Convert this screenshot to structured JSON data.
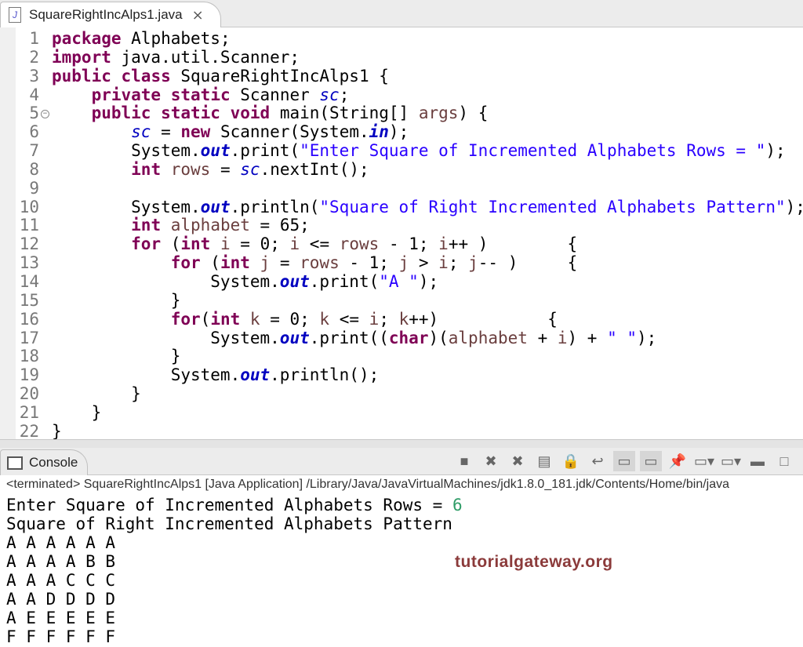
{
  "editor": {
    "tab_title": "SquareRightIncAlps1.java",
    "file_icon": "J",
    "close_icon": "⨯",
    "lines": [
      [
        [
          "k",
          "package"
        ],
        [
          "p",
          " Alphabets;"
        ]
      ],
      [
        [
          "k",
          "import"
        ],
        [
          "p",
          " java.util.Scanner;"
        ]
      ],
      [
        [
          "k",
          "public"
        ],
        [
          "p",
          " "
        ],
        [
          "k",
          "class"
        ],
        [
          "p",
          " SquareRightIncAlps1 {"
        ]
      ],
      [
        [
          "p",
          "    "
        ],
        [
          "k",
          "private"
        ],
        [
          "p",
          " "
        ],
        [
          "k",
          "static"
        ],
        [
          "p",
          " Scanner "
        ],
        [
          "v",
          "sc"
        ],
        [
          "p",
          ";"
        ]
      ],
      [
        [
          "p",
          "    "
        ],
        [
          "k",
          "public"
        ],
        [
          "p",
          " "
        ],
        [
          "k",
          "static"
        ],
        [
          "p",
          " "
        ],
        [
          "k",
          "void"
        ],
        [
          "p",
          " main(String[] "
        ],
        [
          "l",
          "args"
        ],
        [
          "p",
          ") {"
        ]
      ],
      [
        [
          "p",
          "        "
        ],
        [
          "v",
          "sc"
        ],
        [
          "p",
          " = "
        ],
        [
          "k",
          "new"
        ],
        [
          "p",
          " Scanner(System."
        ],
        [
          "f",
          "in"
        ],
        [
          "p",
          ");"
        ]
      ],
      [
        [
          "p",
          "        System."
        ],
        [
          "f",
          "out"
        ],
        [
          "p",
          ".print("
        ],
        [
          "s",
          "\"Enter Square of Incremented Alphabets Rows = \""
        ],
        [
          "p",
          ");"
        ]
      ],
      [
        [
          "p",
          "        "
        ],
        [
          "k",
          "int"
        ],
        [
          "p",
          " "
        ],
        [
          "l",
          "rows"
        ],
        [
          "p",
          " = "
        ],
        [
          "v",
          "sc"
        ],
        [
          "p",
          ".nextInt();"
        ]
      ],
      [
        [
          "p",
          ""
        ]
      ],
      [
        [
          "p",
          "        System."
        ],
        [
          "f",
          "out"
        ],
        [
          "p",
          ".println("
        ],
        [
          "s",
          "\"Square of Right Incremented Alphabets Pattern\""
        ],
        [
          "p",
          ");"
        ]
      ],
      [
        [
          "p",
          "        "
        ],
        [
          "k",
          "int"
        ],
        [
          "p",
          " "
        ],
        [
          "l",
          "alphabet"
        ],
        [
          "p",
          " = 65;"
        ]
      ],
      [
        [
          "p",
          "        "
        ],
        [
          "k",
          "for"
        ],
        [
          "p",
          " ("
        ],
        [
          "k",
          "int"
        ],
        [
          "p",
          " "
        ],
        [
          "l",
          "i"
        ],
        [
          "p",
          " = 0; "
        ],
        [
          "l",
          "i"
        ],
        [
          "p",
          " <= "
        ],
        [
          "l",
          "rows"
        ],
        [
          "p",
          " - 1; "
        ],
        [
          "l",
          "i"
        ],
        [
          "p",
          "++ )        {"
        ]
      ],
      [
        [
          "p",
          "            "
        ],
        [
          "k",
          "for"
        ],
        [
          "p",
          " ("
        ],
        [
          "k",
          "int"
        ],
        [
          "p",
          " "
        ],
        [
          "l",
          "j"
        ],
        [
          "p",
          " = "
        ],
        [
          "l",
          "rows"
        ],
        [
          "p",
          " - 1; "
        ],
        [
          "l",
          "j"
        ],
        [
          "p",
          " > "
        ],
        [
          "l",
          "i"
        ],
        [
          "p",
          "; "
        ],
        [
          "l",
          "j"
        ],
        [
          "p",
          "-- )     {"
        ]
      ],
      [
        [
          "p",
          "                System."
        ],
        [
          "f",
          "out"
        ],
        [
          "p",
          ".print("
        ],
        [
          "s",
          "\"A \""
        ],
        [
          "p",
          ");"
        ]
      ],
      [
        [
          "p",
          "            }"
        ]
      ],
      [
        [
          "p",
          "            "
        ],
        [
          "k",
          "for"
        ],
        [
          "p",
          "("
        ],
        [
          "k",
          "int"
        ],
        [
          "p",
          " "
        ],
        [
          "l",
          "k"
        ],
        [
          "p",
          " = 0; "
        ],
        [
          "l",
          "k"
        ],
        [
          "p",
          " <= "
        ],
        [
          "l",
          "i"
        ],
        [
          "p",
          "; "
        ],
        [
          "l",
          "k"
        ],
        [
          "p",
          "++)           {"
        ]
      ],
      [
        [
          "p",
          "                System."
        ],
        [
          "f",
          "out"
        ],
        [
          "p",
          ".print(("
        ],
        [
          "k",
          "char"
        ],
        [
          "p",
          ")("
        ],
        [
          "l",
          "alphabet"
        ],
        [
          "p",
          " + "
        ],
        [
          "l",
          "i"
        ],
        [
          "p",
          ") + "
        ],
        [
          "s",
          "\" \""
        ],
        [
          "p",
          ");"
        ]
      ],
      [
        [
          "p",
          "            }"
        ]
      ],
      [
        [
          "p",
          "            System."
        ],
        [
          "f",
          "out"
        ],
        [
          "p",
          ".println();"
        ]
      ],
      [
        [
          "p",
          "        }"
        ]
      ],
      [
        [
          "p",
          "    }"
        ]
      ],
      [
        [
          "p",
          "}"
        ]
      ]
    ]
  },
  "console": {
    "tab_label": "Console",
    "status": "<terminated> SquareRightIncAlps1 [Java Application] /Library/Java/JavaVirtualMachines/jdk1.8.0_181.jdk/Contents/Home/bin/java",
    "prompt": "Enter Square of Incremented Alphabets Rows = ",
    "input": "6",
    "output": [
      "Square of Right Incremented Alphabets Pattern",
      "A A A A A A",
      "A A A A B B",
      "A A A C C C",
      "A A D D D D",
      "A E E E E E",
      "F F F F F F"
    ],
    "toolbar": [
      {
        "name": "terminate-button",
        "g": "■"
      },
      {
        "name": "remove-launch-button",
        "g": "✖"
      },
      {
        "name": "remove-all-terminated-button",
        "g": "✖"
      },
      {
        "name": "clear-console-button",
        "g": "▤"
      },
      {
        "name": "scroll-lock-button",
        "g": "🔒"
      },
      {
        "name": "word-wrap-button",
        "g": "↩"
      },
      {
        "name": "show-on-stdout-button",
        "g": "▭"
      },
      {
        "name": "show-on-stderr-button",
        "g": "▭"
      },
      {
        "name": "pin-console-button",
        "g": "📌"
      },
      {
        "name": "display-console-button",
        "g": "▭▾"
      },
      {
        "name": "open-console-button",
        "g": "▭▾"
      },
      {
        "name": "minimize-button",
        "g": "▬"
      },
      {
        "name": "maximize-button",
        "g": "□"
      }
    ]
  },
  "watermark": "tutorialgateway.org"
}
